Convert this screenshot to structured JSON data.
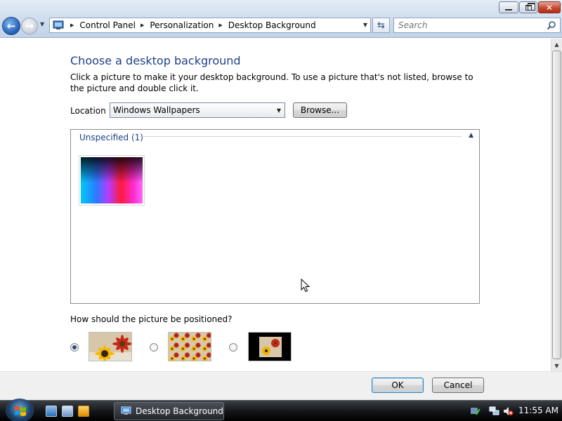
{
  "window": {
    "address": {
      "breadcrumbs": [
        "Control Panel",
        "Personalization",
        "Desktop Background"
      ]
    },
    "search": {
      "placeholder": "Search"
    }
  },
  "page": {
    "title": "Choose a desktop background",
    "description": "Click a picture to make it your desktop background. To use a picture that's not listed, browse to the picture and double click it.",
    "location": {
      "label": "Location",
      "selected": "Windows Wallpapers"
    },
    "browse_label": "Browse...",
    "gallery": {
      "group_header": "Unspecified (1)"
    },
    "positioning": {
      "label": "How should the picture be positioned?",
      "options": [
        {
          "name": "fill",
          "selected": true
        },
        {
          "name": "tile",
          "selected": false
        },
        {
          "name": "center",
          "selected": false
        }
      ]
    }
  },
  "footer": {
    "ok_label": "OK",
    "cancel_label": "Cancel"
  },
  "taskbar": {
    "task_label": "Desktop Background",
    "clock": "11:55 AM"
  },
  "colors": {
    "title_blue": "#1e3f8a",
    "accent": "#3c7fb1"
  }
}
